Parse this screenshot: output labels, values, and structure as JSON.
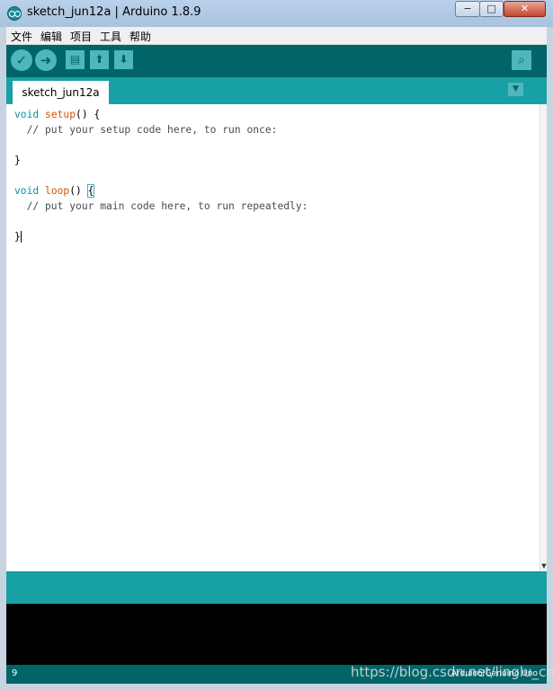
{
  "window": {
    "title": "sketch_jun12a | Arduino 1.8.9",
    "minimize_glyph": "−",
    "maximize_glyph": "□",
    "close_glyph": "✕"
  },
  "menu": {
    "items": [
      "文件",
      "编辑",
      "项目",
      "工具",
      "帮助"
    ]
  },
  "toolbar": {
    "verify_glyph": "✓",
    "upload_glyph": "➜",
    "new_glyph": "▤",
    "open_glyph": "⬆",
    "save_glyph": "⬇",
    "serial_monitor_glyph": "⌕"
  },
  "tabs": {
    "items": [
      {
        "label": "sketch_jun12a"
      }
    ],
    "menu_glyph": "▼"
  },
  "editor": {
    "lines": {
      "l1_kw": "void",
      "l1_fn": "setup",
      "l1_rest": "() {",
      "l2": "  // put your setup code here, to run once:",
      "l4": "}",
      "l6_kw": "void",
      "l6_fn": "loop",
      "l6_rest": "() ",
      "l6_brace": "{",
      "l7": "  // put your main code here, to run repeatedly:",
      "l9": "}"
    },
    "scroll_down_glyph": "▼"
  },
  "status": {
    "line_number": "9",
    "board": "Arduino/Genuino Uno"
  },
  "watermark": "https://blog.csdn.net/linglu_cmi",
  "colors": {
    "toolbar": "#006468",
    "tabbar": "#17a1a5",
    "keyword": "#00979c",
    "function": "#d35400",
    "comment": "#434f54",
    "console": "#000000"
  },
  "icons": {
    "app": "arduino-logo-icon",
    "verify": "checkmark-icon",
    "upload": "arrow-right-icon",
    "new": "new-file-icon",
    "open": "arrow-up-icon",
    "save": "arrow-down-icon",
    "serial_monitor": "magnifier-icon",
    "tab_menu": "chevron-down-icon"
  }
}
